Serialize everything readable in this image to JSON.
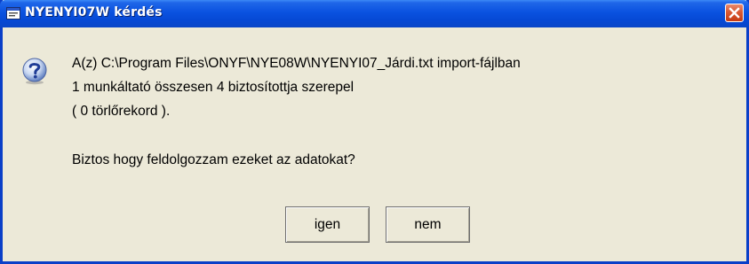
{
  "window": {
    "title": "NYENYI07W kérdés"
  },
  "message": {
    "lines": [
      "A(z) C:\\Program Files\\ONYF\\NYE08W\\NYENYI07_Járdi.txt import-fájlban",
      "1 munkáltató összesen 4 biztosítottja szerepel",
      "( 0 törlőrekord ).",
      "Biztos hogy feldolgozzam ezeket az adatokat?"
    ]
  },
  "buttons": {
    "yes_label": "igen",
    "no_label": "nem"
  },
  "icons": {
    "title": "app-window-icon",
    "message": "question-icon",
    "close": "close-icon"
  },
  "colors": {
    "titlebar": "#0a52e0",
    "dialog_bg": "#ece9d8",
    "close_button": "#d95a34"
  }
}
